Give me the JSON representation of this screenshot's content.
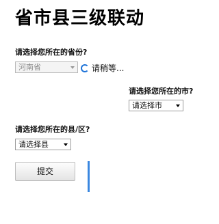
{
  "page": {
    "title": "省市县三级联动"
  },
  "province": {
    "label": "请选择您所在的省份?",
    "selected": "河南省",
    "loading_text": "请稍等..."
  },
  "city": {
    "label": "请选择您所在的市?",
    "selected": "请选择市"
  },
  "county": {
    "label": "请选择您所在的县/区?",
    "selected": "请选择县"
  },
  "form": {
    "submit_label": "提交"
  },
  "colors": {
    "accent": "#3a87e0",
    "spinner": "#1e73d8"
  }
}
